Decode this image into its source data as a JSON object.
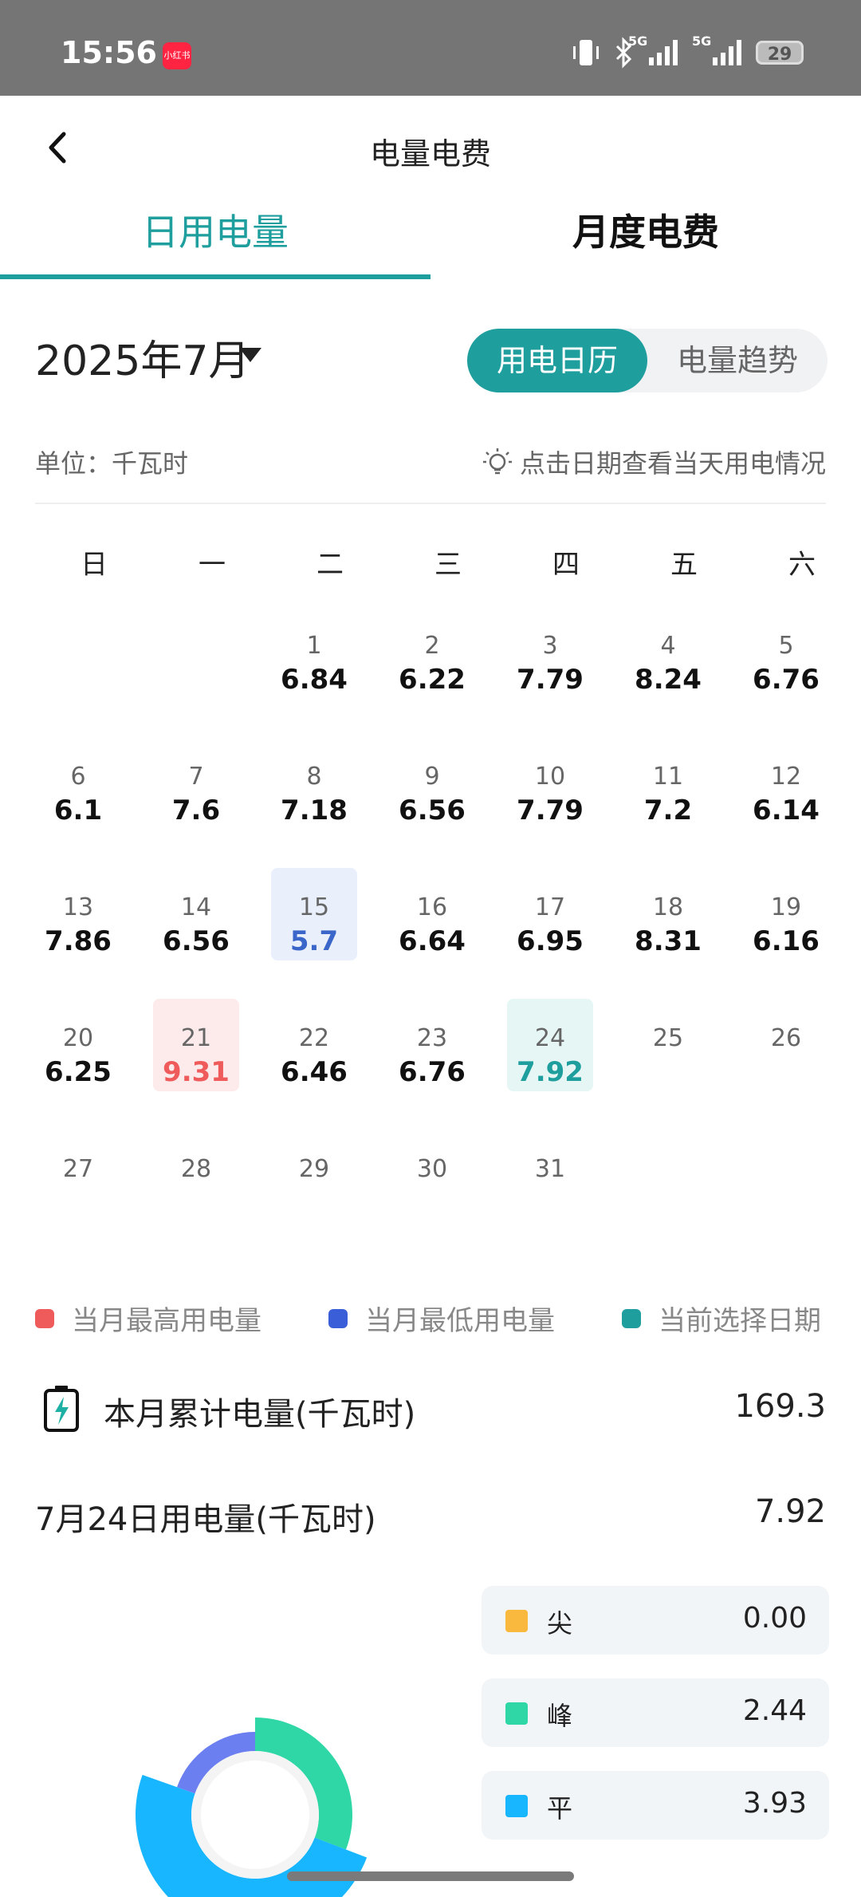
{
  "status_bar": {
    "time": "15:56",
    "app_badge": "小红书",
    "net1": "5G",
    "net2": "5G",
    "battery": "29"
  },
  "header": {
    "title": "电量电费",
    "back_icon": "chevron-left-icon"
  },
  "tabs": [
    {
      "label": "日用电量",
      "active": true
    },
    {
      "label": "月度电费",
      "active": false
    }
  ],
  "month_picker": {
    "label": "2025年7月"
  },
  "view_toggle": {
    "options": [
      "用电日历",
      "电量趋势"
    ],
    "selected": "用电日历"
  },
  "unit_label": "单位：千瓦时",
  "hint": "点击日期查看当天用电情况",
  "weekdays": [
    "日",
    "一",
    "二",
    "三",
    "四",
    "五",
    "六"
  ],
  "calendar": {
    "first_weekday": 2,
    "days": [
      {
        "d": "1",
        "v": "6.84"
      },
      {
        "d": "2",
        "v": "6.22"
      },
      {
        "d": "3",
        "v": "7.79"
      },
      {
        "d": "4",
        "v": "8.24"
      },
      {
        "d": "5",
        "v": "6.76"
      },
      {
        "d": "6",
        "v": "6.1"
      },
      {
        "d": "7",
        "v": "7.6"
      },
      {
        "d": "8",
        "v": "7.18"
      },
      {
        "d": "9",
        "v": "6.56"
      },
      {
        "d": "10",
        "v": "7.79"
      },
      {
        "d": "11",
        "v": "7.2"
      },
      {
        "d": "12",
        "v": "6.14"
      },
      {
        "d": "13",
        "v": "7.86"
      },
      {
        "d": "14",
        "v": "6.56"
      },
      {
        "d": "15",
        "v": "5.7",
        "state": "low"
      },
      {
        "d": "16",
        "v": "6.64"
      },
      {
        "d": "17",
        "v": "6.95"
      },
      {
        "d": "18",
        "v": "8.31"
      },
      {
        "d": "19",
        "v": "6.16"
      },
      {
        "d": "20",
        "v": "6.25"
      },
      {
        "d": "21",
        "v": "9.31",
        "state": "high"
      },
      {
        "d": "22",
        "v": "6.46"
      },
      {
        "d": "23",
        "v": "6.76"
      },
      {
        "d": "24",
        "v": "7.92",
        "state": "sel"
      },
      {
        "d": "25",
        "v": ""
      },
      {
        "d": "26",
        "v": ""
      },
      {
        "d": "27",
        "v": ""
      },
      {
        "d": "28",
        "v": ""
      },
      {
        "d": "29",
        "v": ""
      },
      {
        "d": "30",
        "v": ""
      },
      {
        "d": "31",
        "v": ""
      }
    ]
  },
  "legend": [
    {
      "label": "当月最高用电量",
      "color": "#ef5b5b"
    },
    {
      "label": "当月最低用电量",
      "color": "#3a5ed8"
    },
    {
      "label": "当前选择日期",
      "color": "#1f9e9e"
    }
  ],
  "month_total": {
    "label": "本月累计电量(千瓦时)",
    "value": "169.3"
  },
  "day_total": {
    "label": "7月24日用电量(千瓦时)",
    "value": "7.92"
  },
  "tariffs": [
    {
      "name": "尖",
      "value": "0.00",
      "color": "#f9b93e"
    },
    {
      "name": "峰",
      "value": "2.44",
      "color": "#2ed7a5"
    },
    {
      "name": "平",
      "value": "3.93",
      "color": "#18b6ff"
    }
  ],
  "donut_colors": {
    "valley": "#6b7ff0"
  }
}
